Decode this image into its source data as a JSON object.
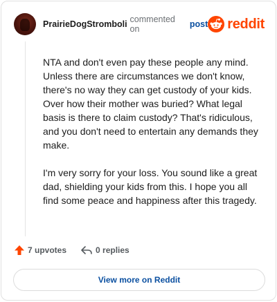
{
  "header": {
    "author": "PrairieDogStromboli",
    "action_text": "commented on",
    "post_link": "post",
    "brand_name": "reddit"
  },
  "comment": {
    "paragraphs": [
      "NTA and don't even pay these people any mind. Unless there are circumstances we don't know, there's no way they can get custody of your kids. Over how their mother was buried? What legal basis is there to claim custody? That's ridiculous, and you don't need to entertain any demands they make.",
      "I'm very sorry for your loss. You sound like a great dad, shielding your kids from this. I hope you all find some peace and happiness after this tragedy."
    ]
  },
  "stats": {
    "upvotes": "7 upvotes",
    "replies": "0 replies"
  },
  "footer": {
    "view_more": "View more on Reddit"
  },
  "icons": {
    "upvote": "upvote-arrow-icon",
    "reply": "reply-arrow-icon",
    "brand": "reddit-snoo-icon"
  },
  "colors": {
    "brand": "#ff4500",
    "link": "#0a4fa0",
    "muted": "#6b6f73"
  }
}
